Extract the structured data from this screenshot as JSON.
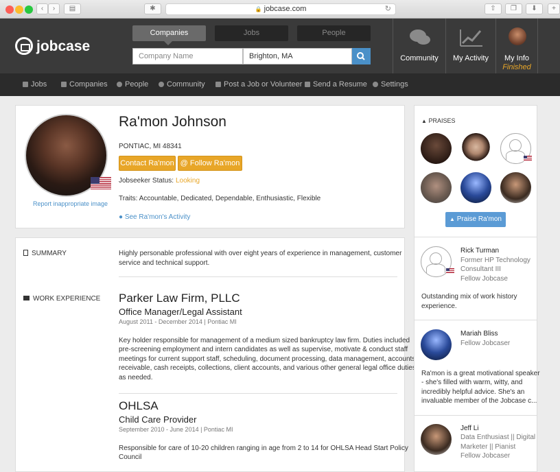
{
  "browser": {
    "url": "jobcase.com"
  },
  "brand": {
    "name": "jobcase",
    "accent": "#e8a628",
    "link": "#4a90c8"
  },
  "search": {
    "tabs": [
      "Companies",
      "Jobs",
      "People"
    ],
    "company_placeholder": "Company Name",
    "location_value": "Brighton, MA"
  },
  "header_nav": [
    {
      "label": "Community",
      "icon": "chat-bubbles-icon"
    },
    {
      "label": "My Activity",
      "icon": "activity-chart-icon"
    },
    {
      "label": "My Info",
      "sub": "Finished",
      "icon": "user-avatar"
    }
  ],
  "subnav": [
    "Jobs",
    "Companies",
    "People",
    "Community",
    "Post a Job or Volunteer",
    "Send a Resume",
    "Settings"
  ],
  "profile": {
    "name": "Ra'mon Johnson",
    "location": "PONTIAC, MI 48341",
    "contact_btn": "Contact Ra'mon",
    "follow_btn": "Follow Ra'mon",
    "status_label": "Jobseeker Status:",
    "status_value": "Looking",
    "traits": "Traits: Accountable, Dedicated, Dependable, Enthusiastic, Flexible",
    "activity_link": "See Ra'mon's Activity",
    "report_link": "Report inappropriate image"
  },
  "summary": {
    "heading": "SUMMARY",
    "text_lines": [
      "Highly personable professional with over eight years of experience in management, customer",
      "service and technical support."
    ]
  },
  "work": {
    "heading": "WORK EXPERIENCE",
    "jobs": [
      {
        "company": "Parker Law Firm, PLLC",
        "title": "Office Manager/Legal Assistant",
        "dates": "August 2011 - December 2014 | Pontiac MI",
        "desc_lines": [
          "Key holder responsible for management of a medium sized bankruptcy law firm. Duties included",
          "pre-screening employment and intern candidates as well as supervise, motivate & conduct staff",
          "meetings for current support staff, scheduling, document processing, data management, accounts",
          "receivable, cash receipts, collections, client accounts, and various other general legal office duties",
          "as needed."
        ]
      },
      {
        "company": "OHLSA",
        "title": "Child Care Provider",
        "dates": "September 2010 - June 2014 | Pontiac MI",
        "desc_lines": [
          "Responsible for care of 10-20 children ranging in age from 2 to 14 for OHLSA Head Start Policy",
          "Council"
        ]
      }
    ]
  },
  "praises": {
    "heading": "PRAISES",
    "button": "Praise Ra'mon",
    "reviews": [
      {
        "name": "Rick Turman",
        "role_lines": [
          "Former HP Technology",
          "Consultant III",
          "Fellow Jobcase"
        ],
        "text_lines": [
          "Outstanding mix of work history",
          "experience."
        ]
      },
      {
        "name": "Mariah Bliss",
        "role_lines": [
          "Fellow Jobcaser"
        ],
        "text_lines": [
          "Ra'mon is a great motivational speaker",
          "- she's filled with warm, witty, and",
          "incredibly helpful advice. She's an",
          "invaluable member of the Jobcase c..."
        ]
      },
      {
        "name": "Jeff Li",
        "role_lines": [
          "Data Enthusiast || Digital",
          "Marketer || Pianist",
          "Fellow Jobcaser"
        ],
        "text_lines": []
      }
    ]
  }
}
